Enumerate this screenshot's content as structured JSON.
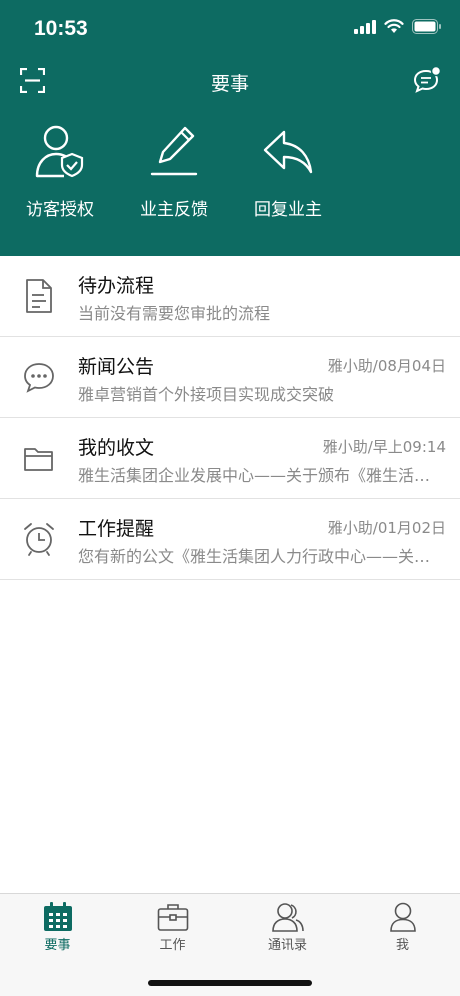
{
  "status_bar": {
    "time": "10:53"
  },
  "header": {
    "title": "要事",
    "bg_color": "#0d6b62",
    "left_icon": "scan-icon",
    "right_icon": "message-bubble-icon"
  },
  "quick_actions": [
    {
      "label": "访客授权",
      "icon": "visitor-auth-icon"
    },
    {
      "label": "业主反馈",
      "icon": "pencil-feedback-icon"
    },
    {
      "label": "回复业主",
      "icon": "reply-arrow-icon"
    }
  ],
  "list": [
    {
      "title": "待办流程",
      "meta": "",
      "subtitle": "当前没有需要您审批的流程",
      "icon": "document-icon"
    },
    {
      "title": "新闻公告",
      "meta": "雅小助/08月04日",
      "subtitle": "雅卓营销首个外接项目实现成交突破",
      "icon": "chat-bubble-icon"
    },
    {
      "title": "我的收文",
      "meta": "雅小助/早上09:14",
      "subtitle": "雅生活集团企业发展中心——关于颁布《雅生活集团企业发展中心管理办法》的通知",
      "icon": "folder-icon"
    },
    {
      "title": "工作提醒",
      "meta": "雅小助/01月02日",
      "subtitle": "您有新的公文《雅生活集团人力行政中心——关于员工培训的通知》",
      "icon": "alarm-clock-icon"
    }
  ],
  "tabbar": {
    "items": [
      {
        "label": "要事",
        "icon": "calendar-icon",
        "active": true
      },
      {
        "label": "工作",
        "icon": "briefcase-icon",
        "active": false
      },
      {
        "label": "通讯录",
        "icon": "contacts-icon",
        "active": false
      },
      {
        "label": "我",
        "icon": "person-icon",
        "active": false
      }
    ],
    "active_color": "#0d6b62"
  }
}
